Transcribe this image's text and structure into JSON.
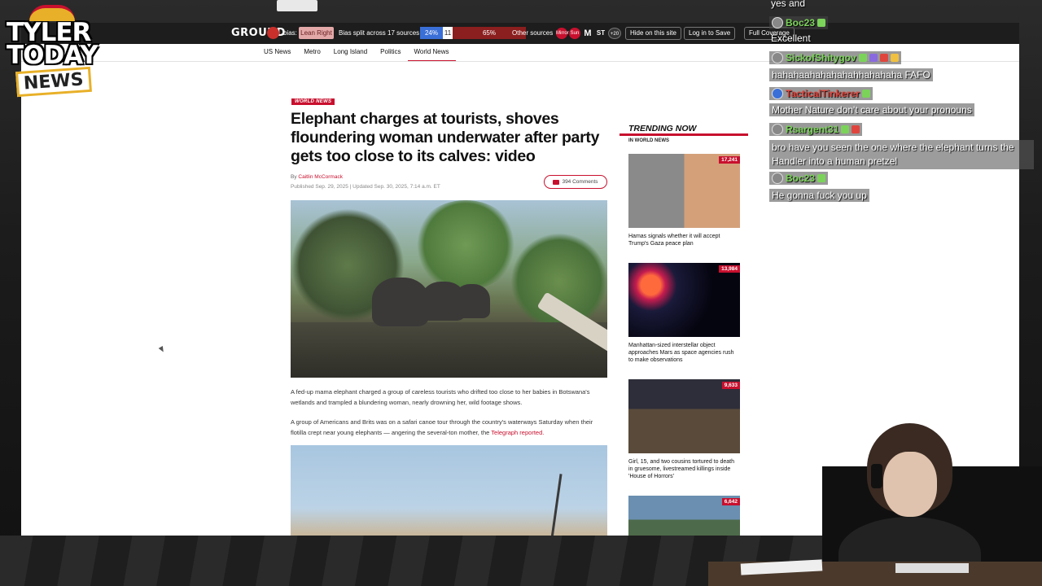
{
  "logo": {
    "line1": "TYLER",
    "line2": "TODAY",
    "line3": "NEWS"
  },
  "ground_news": {
    "brand": "GROUND",
    "bias_label": "bias:",
    "lean": "Lean Right",
    "split_text": "Bias split across 17 sources",
    "left_pct": "24%",
    "center_pct": "11",
    "right_pct": "65%",
    "other_sources": "Other sources",
    "source_icons": [
      "Mirror",
      "Sun",
      "M",
      "ST"
    ],
    "more_sources": "+20",
    "hide_btn": "Hide on this site",
    "login_btn": "Log in to Save",
    "full_btn": "Full Coverage"
  },
  "nav": {
    "items": [
      "US News",
      "Metro",
      "Long Island",
      "Politics",
      "World News"
    ],
    "active": "World News"
  },
  "article": {
    "kicker": "WORLD NEWS",
    "headline": "Elephant charges at tourists, shoves floundering woman underwater after party gets too close to its calves: video",
    "by": "By",
    "author": "Caitlin McCormack",
    "published": "Published Sep. 29, 2025",
    "updated": "Updated Sep. 30, 2025, 7:14 a.m. ET",
    "comments": "394 Comments",
    "para1": "A fed-up mama elephant charged a group of careless tourists who drifted too close to her babies in Botswana's wetlands and trampled a blundering woman, nearly drowning her, wild footage shows.",
    "para2_pre": "A group of Americans and Brits was on a safari canoe tour through the country's waterways Saturday when their flotilla crept near young elephants — angering the several-ton mother, the",
    "para2_link": "Telegraph reported."
  },
  "trending": {
    "title": "TRENDING NOW",
    "subtitle": "IN WORLD NEWS",
    "items": [
      {
        "count": "17,241",
        "caption": "Hamas signals whether it will accept Trump's Gaza peace plan"
      },
      {
        "count": "13,984",
        "caption": "Manhattan-sized interstellar object approaches Mars as space agencies rush to make observations"
      },
      {
        "count": "9,633",
        "caption": "Girl, 15, and two cousins tortured to death in gruesome, livestreamed killings inside 'House of Horrors'"
      },
      {
        "count": "6,642",
        "caption": ""
      }
    ]
  },
  "chat": {
    "top_line": "yes and",
    "messages": [
      {
        "user": "Boc23",
        "text": "Excellent",
        "color": "#7bd35a"
      },
      {
        "user": "SickofShitygov",
        "text": "hahahaahahahahahhahahaha FAFO",
        "color": "#7bd35a"
      },
      {
        "user": "TacticalTinkerer",
        "text": "Mother Nature don't care about your pronouns",
        "color": "#e0453d"
      },
      {
        "user": "Rsargent31",
        "text": "bro have you seen the one where the elephant turns the Handler into a human pretzel",
        "color": "#7bd35a"
      },
      {
        "user": "Boc23",
        "text": "He gonna fuck you up",
        "color": "#7bd35a"
      }
    ]
  },
  "colors": {
    "brand_red": "#c8102e",
    "left_blue": "#3a6fd8",
    "right_red": "#8b1e1e"
  }
}
